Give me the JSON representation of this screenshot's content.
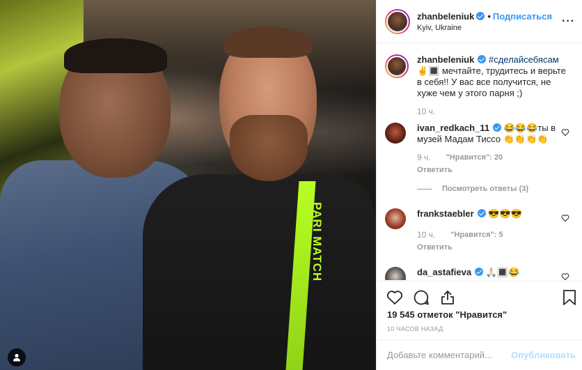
{
  "post": {
    "author": "zhanbeleniuk",
    "follow_label": "Подписаться",
    "dot": "•",
    "location": "Kyiv, Ukraine",
    "more_label": "···",
    "photo_brand_text": "PARI MATCH"
  },
  "caption": {
    "username": "zhanbeleniuk",
    "hashtag": "#сделайсебясам",
    "text": " ✌️🔳 мечтайте, трудитесь и верьте в себя!! У вас все получится, не хуже чем у этого парня ;)",
    "time": "10 ч."
  },
  "comments": [
    {
      "username": "ivan_redkach_11",
      "text": " 😂😂😂ты в музей Мадам Тиссо 👏👏👏👏",
      "time": "9 ч.",
      "likes": "\"Нравится\": 20",
      "reply_label": "Ответить",
      "view_replies": "Посмотреть ответы (3)"
    },
    {
      "username": "frankstaebler",
      "text": " 😎😎😎",
      "time": "10 ч.",
      "likes": "\"Нравится\": 5",
      "reply_label": "Ответить"
    },
    {
      "username": "da_astafieva",
      "text": " 🙏🏻🔳😂"
    }
  ],
  "footer": {
    "likes_count": "19 545 отметок \"Нравится\"",
    "posted_ago": "10 часов назад",
    "comment_placeholder": "Добавьте комментарий...",
    "publish_label": "Опубликовать"
  },
  "colors": {
    "link_blue": "#3897f0",
    "hashtag": "#003569",
    "muted": "#999999",
    "publish_disabled": "#b2dffc",
    "brand_neon": "#b9ff23"
  }
}
